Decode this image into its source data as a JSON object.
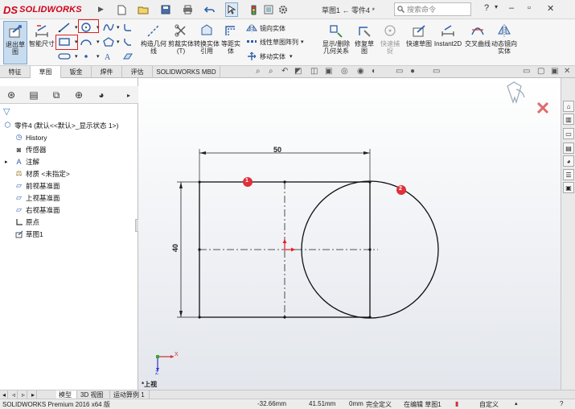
{
  "app": {
    "logo_mark": "DS",
    "logo_text": "SOLIDWORKS",
    "document_title": "草图1 ← 零件4 *"
  },
  "search": {
    "placeholder": "搜索命令"
  },
  "commands": {
    "exit_sketch": "退出草图",
    "smart_dimension": "智能尺寸",
    "trim_entities": "剪裁实体(T)",
    "convert_entities": "转换实体引用",
    "offset_entities": "等距实体",
    "construction_geometry": "构造几何线",
    "mirror_entities": "镜向实体",
    "linear_pattern": "线性草图阵列",
    "move_entities": "移动实体",
    "display_delete_relations": "显示/删除几何关系",
    "repair_sketch": "修复草图",
    "quick_snaps": "快速捕捉",
    "rapid_sketch": "快速草图",
    "instant2d": "Instant2D",
    "intersection_curve": "交叉曲线",
    "dynamic_mirror": "动态镜向实体"
  },
  "tabs": [
    "特征",
    "草图",
    "钣金",
    "焊件",
    "评估",
    "SOLIDWORKS MBD"
  ],
  "active_tab": 1,
  "tree": {
    "root": "零件4 (默认<<默认>_显示状态 1>)",
    "items": [
      "History",
      "传感器",
      "注解",
      "材质 <未指定>",
      "前视基准面",
      "上视基准面",
      "右视基准面",
      "原点",
      "草图1"
    ]
  },
  "sketch": {
    "dim_width": "50",
    "dim_height": "40",
    "marker_1": "1",
    "marker_2": "2",
    "view_label": "*上视",
    "axis_x": "X",
    "axis_z": "Z"
  },
  "bottom_tabs": [
    "模型",
    "3D 视图",
    "运动算例 1"
  ],
  "active_bottom_tab": 0,
  "status": {
    "product": "SOLIDWORKS Premium 2016 x64 版",
    "x": "-32.66mm",
    "y": "41.51mm",
    "z": "0mm",
    "constraint": "完全定义",
    "editing": "在编辑 草图1",
    "units": "自定义"
  },
  "colors": {
    "brand": "#d0021b",
    "highlight": "#e02020",
    "marker": "#e0303a",
    "accent_blue": "#3a7bc8"
  }
}
